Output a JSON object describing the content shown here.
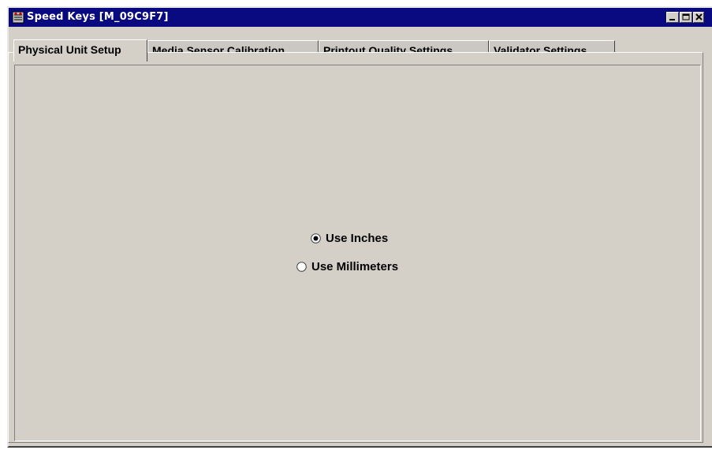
{
  "window": {
    "title": "Speed Keys [M_09C9F7]",
    "titlebar_color": "#0a0a80",
    "background_color": "#d4d0c8",
    "controls": [
      "minimize-icon",
      "maximize-icon",
      "close-icon"
    ]
  },
  "tabs": [
    {
      "label": "Physical Unit Setup",
      "active": true
    },
    {
      "label": "Media Sensor Calibration",
      "active": false
    },
    {
      "label": "Printout Quality Settings",
      "active": false
    },
    {
      "label": "Validator Settings",
      "active": false
    }
  ],
  "units": {
    "options": [
      {
        "label": "Use Inches",
        "selected": true
      },
      {
        "label": "Use Millimeters",
        "selected": false
      }
    ]
  }
}
